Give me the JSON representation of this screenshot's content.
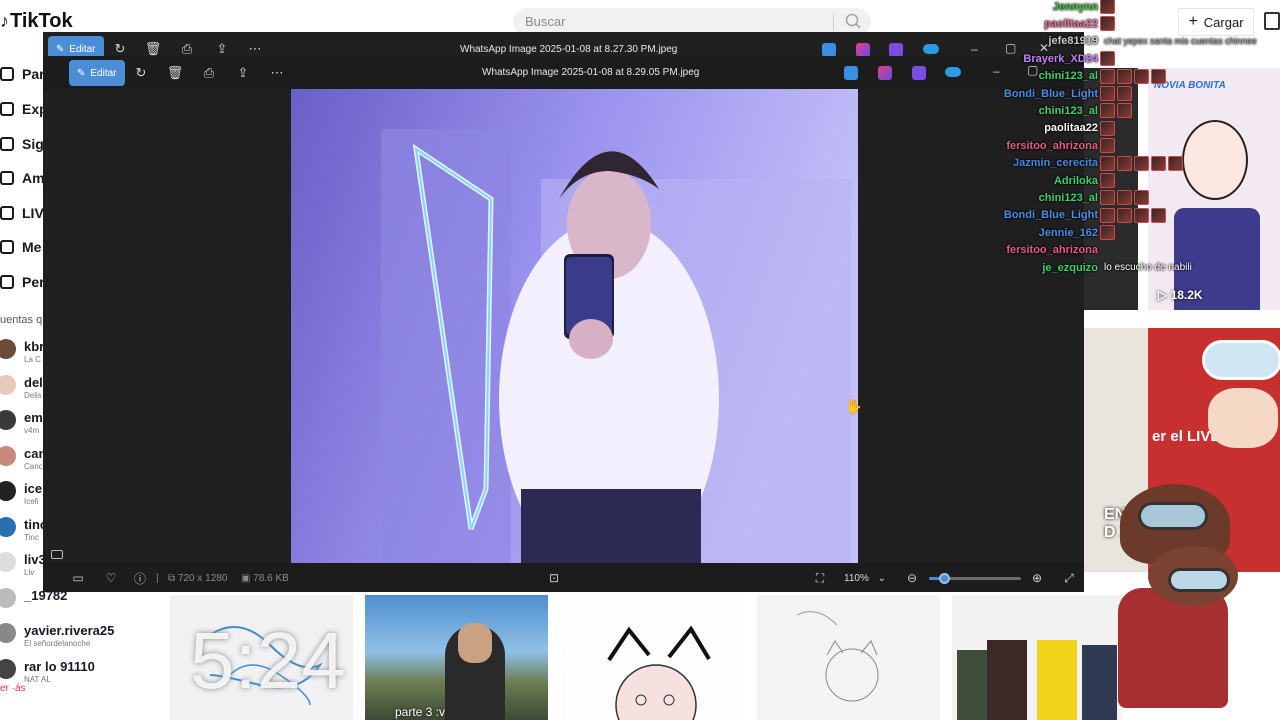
{
  "tiktok": {
    "logo": "TikTok",
    "search_placeholder": "Buscar",
    "upload_label": "Cargar",
    "nav": [
      {
        "label": "Par",
        "icon": "home-icon"
      },
      {
        "label": "Exp",
        "icon": "compass-icon"
      },
      {
        "label": "Sig",
        "icon": "following-icon"
      },
      {
        "label": "Am",
        "icon": "friends-icon"
      },
      {
        "label": "LIV",
        "icon": "live-icon"
      },
      {
        "label": "Me",
        "icon": "messages-icon"
      },
      {
        "label": "Per",
        "icon": "profile-icon"
      }
    ],
    "following_heading": "uentas q",
    "following": [
      {
        "user": "kbr",
        "name": "La C"
      },
      {
        "user": "del",
        "name": "Delis"
      },
      {
        "user": "em",
        "name": "v4m"
      },
      {
        "user": "can",
        "name": "Canc"
      },
      {
        "user": "ice",
        "name": "Icefi"
      },
      {
        "user": "tinc",
        "name": "Tinc"
      },
      {
        "user": "liv3",
        "name": "Liv"
      },
      {
        "user": "_19782",
        "name": ""
      },
      {
        "user": "yavier.rivera25",
        "name": "El señordelanoche"
      },
      {
        "user": "rar lo 91110",
        "name": "NAT AL"
      }
    ],
    "see_more": "er ·ás",
    "clock_overlay": "5:24",
    "thumb_caption": "parte 3 :v",
    "right_thumb_views": "18.2K",
    "right_thumb_title": "NOVIA BONITA",
    "right_thumb_live_text": "er el LIVE",
    "right_thumb_side_text": "ENT D X",
    "chat_message_line": "lo escucho de nabili"
  },
  "viewer_back": {
    "edit_label": "Editar",
    "title": "WhatsApp Image 2025-01-08 at 8.27.30 PM.jpeg"
  },
  "viewer_front": {
    "edit_label": "Editar",
    "title": "WhatsApp Image 2025-01-08 at 8.29.05 PM.jpeg",
    "photo_description_icon": "image-icon"
  },
  "bottom_bar": {
    "dimensions": "720 x 1280",
    "file_size": "78.6 KB",
    "zoom": "110%",
    "zoom_fraction": 0.16
  },
  "chat": [
    {
      "user": "Jennynn",
      "color": "#41c23f",
      "emotes": 1,
      "msg": ""
    },
    {
      "user": "paolitaa22",
      "color": "#e86b9b",
      "emotes": 1,
      "msg": ""
    },
    {
      "user": "jefe81919",
      "color": "#c9c9c9",
      "emotes": 0,
      "msg": "chat yepex santa mis cuentas chinnee"
    },
    {
      "user": "Brayerk_XD24",
      "color": "#c77dff",
      "emotes": 1,
      "msg": ""
    },
    {
      "user": "chini123_al",
      "color": "#3ad36b",
      "emotes": 4,
      "msg": ""
    },
    {
      "user": "Bondi_Blue_Light",
      "color": "#4a8fe8",
      "emotes": 2,
      "msg": ""
    },
    {
      "user": "chini123_al",
      "color": "#3ad36b",
      "emotes": 2,
      "msg": ""
    },
    {
      "user": "paolitaa22",
      "color": "#ffffff",
      "emotes": 1,
      "msg": ""
    },
    {
      "user": "fersitoo_ahrizona",
      "color": "#e85a86",
      "emotes": 1,
      "msg": ""
    },
    {
      "user": "Jazmin_cerecita",
      "color": "#3f8ae8",
      "emotes": 5,
      "msg": ""
    },
    {
      "user": "Adriloka",
      "color": "#3ad36b",
      "emotes": 1,
      "msg": ""
    },
    {
      "user": "chini123_al",
      "color": "#3ad36b",
      "emotes": 3,
      "msg": ""
    },
    {
      "user": "Bondi_Blue_Light",
      "color": "#4a8fe8",
      "emotes": 4,
      "msg": ""
    },
    {
      "user": "Jennie_162",
      "color": "#4a8fe8",
      "emotes": 1,
      "msg": ""
    },
    {
      "user": "fersitoo_ahrizona",
      "color": "#e85a86",
      "emotes": 0,
      "msg": ""
    },
    {
      "user": "je_ezquizo",
      "color": "#3ad36b",
      "emotes": 0,
      "msg": "lo escucho de nabili"
    }
  ],
  "colors": {
    "accent": "#4c8ed6",
    "viewer_bg": "#1f1f1f",
    "tiktok_red": "#fe2c55"
  }
}
